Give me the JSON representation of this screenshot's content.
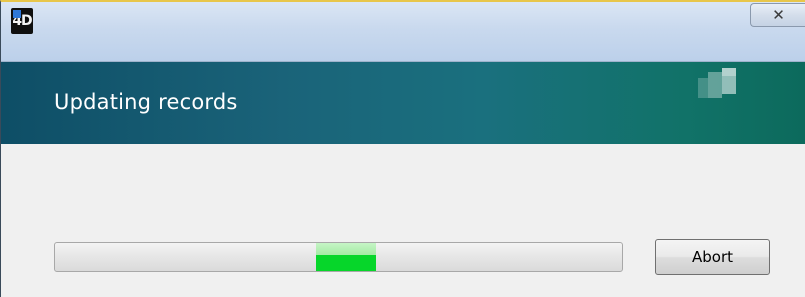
{
  "window": {
    "close_glyph": "✕",
    "app_icon_text": "4D"
  },
  "banner": {
    "title": "Updating records",
    "background_colors": [
      "#0e4e66",
      "#117268"
    ]
  },
  "progress": {
    "mode": "indeterminate",
    "marquee_position_fraction": 0.46,
    "marquee_color": "#06d62a"
  },
  "actions": {
    "abort_label": "Abort"
  },
  "icons": {
    "app": "4d-app-icon",
    "close": "close-icon",
    "banner_logo": "4d-logo-icon"
  }
}
